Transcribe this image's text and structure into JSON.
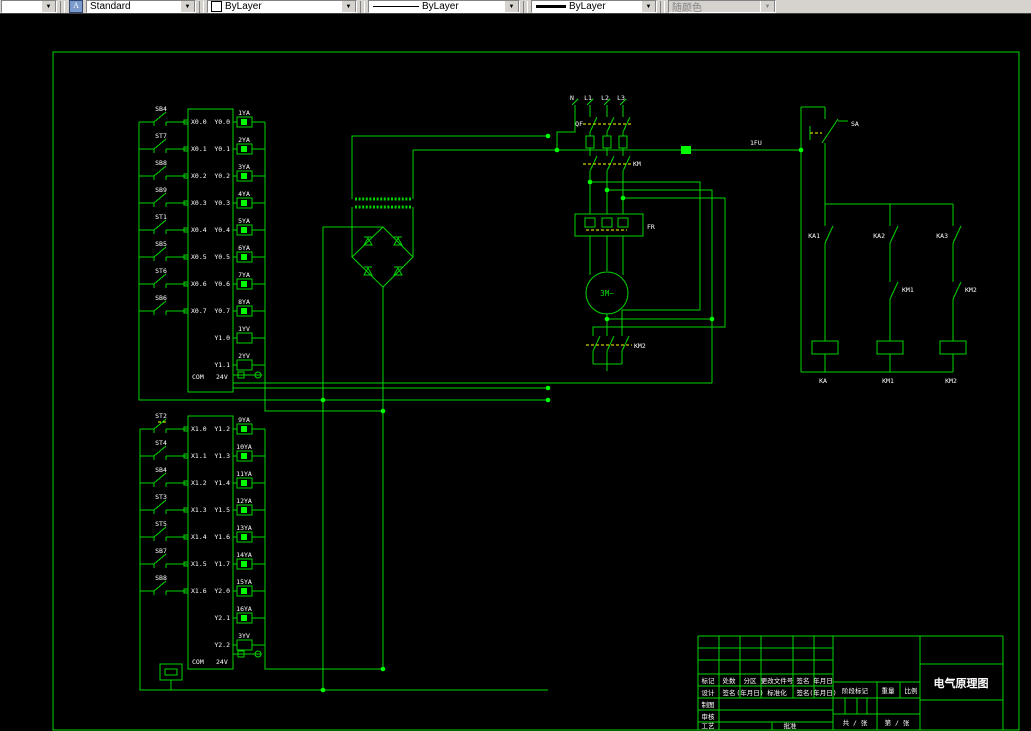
{
  "toolbar": {
    "text_style": {
      "value": "Standard"
    },
    "color": {
      "value": "ByLayer"
    },
    "linetype": {
      "value": "ByLayer"
    },
    "lineweight": {
      "value": "ByLayer"
    },
    "plot_style": {
      "value": "随颜色"
    },
    "arrow": "▼",
    "icon_glyph": "A"
  },
  "colors": {
    "line": "#00d400",
    "bright": "#00ff00",
    "link": "#ffff00",
    "text": "#ffffff",
    "toolbar_bg": "#d6d3ce"
  },
  "schematic": {
    "top_block": {
      "switches": [
        "SB4",
        "ST7",
        "SB8",
        "SB9",
        "ST1",
        "SB5",
        "ST6",
        "SB6"
      ],
      "inputs": [
        "X0.0",
        "X0.1",
        "X0.2",
        "X0.3",
        "X0.4",
        "X0.5",
        "X0.6",
        "X0.7"
      ],
      "outputs": [
        "Y0.0",
        "Y0.1",
        "Y0.2",
        "Y0.3",
        "Y0.4",
        "Y0.5",
        "Y0.6",
        "Y0.7",
        "Y1.0",
        "Y1.1"
      ],
      "coils": [
        "1YA",
        "2YA",
        "3YA",
        "4YA",
        "5YA",
        "6YA",
        "7YA",
        "8YA",
        "1YV",
        "2YV"
      ],
      "com": "COM",
      "v24": "24V"
    },
    "bottom_block": {
      "switches": [
        "ST2",
        "ST4",
        "SB4",
        "ST3",
        "ST5",
        "SB7",
        "SB8"
      ],
      "inputs": [
        "X1.0",
        "X1.1",
        "X1.2",
        "X1.3",
        "X1.4",
        "X1.5",
        "X1.6"
      ],
      "outputs": [
        "Y1.2",
        "Y1.3",
        "Y1.4",
        "Y1.5",
        "Y1.6",
        "Y1.7",
        "Y2.0",
        "Y2.1",
        "Y2.2"
      ],
      "coils": [
        "9YA",
        "10YA",
        "11YA",
        "12YA",
        "13YA",
        "14YA",
        "15YA",
        "16YA",
        "3YV"
      ],
      "com": "COM",
      "v24": "24V"
    },
    "power": {
      "n": "N",
      "l1": "L1",
      "l2": "L2",
      "l3": "L3",
      "breaker": "QF",
      "contactor": "KM",
      "thermal": "FR",
      "motor": "3M~",
      "fuse": "1FU",
      "contactor2": "KM2"
    },
    "ladder": {
      "disconnect": "SA",
      "contacts_top": [
        "KA1",
        "KA2",
        "KA3"
      ],
      "contacts_mid": [
        "KM1",
        "KM2"
      ],
      "coil_labels": [
        "KA",
        "KM1",
        "KM2"
      ]
    }
  },
  "title_block": {
    "row_top": [
      "标记",
      "处数",
      "分区",
      "更改文件号",
      "签名",
      "年月日"
    ],
    "row_2": [
      "设计",
      "签名",
      "(年月日)",
      "标准化",
      "签名",
      "(年月日)"
    ],
    "draw": "制图",
    "check": "审核",
    "craft": "工艺",
    "approve": "批准",
    "stage_mark": "阶段标记",
    "weight": "重量",
    "scale": "比例",
    "title": "电气原理图",
    "sheets_total": "共 / 张",
    "sheet_no": "第 / 张"
  }
}
